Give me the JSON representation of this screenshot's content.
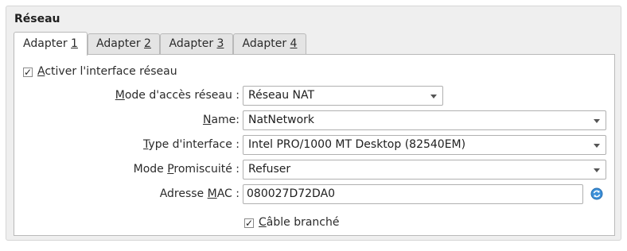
{
  "section": {
    "title": "Réseau"
  },
  "tabs": [
    {
      "label_pre": "Adapter ",
      "label_key": "1"
    },
    {
      "label_pre": "Adapter ",
      "label_key": "2"
    },
    {
      "label_pre": "Adapter ",
      "label_key": "3"
    },
    {
      "label_pre": "Adapter ",
      "label_key": "4"
    }
  ],
  "enable": {
    "label_key": "A",
    "label_rest": "ctiver l'interface réseau",
    "checked_glyph": "✓"
  },
  "attachment": {
    "label_key": "M",
    "label_rest": "ode d'accès réseau :",
    "value": "Réseau NAT"
  },
  "name": {
    "label_key": "N",
    "label_rest": "ame:",
    "value": "NatNetwork"
  },
  "adapter_type": {
    "label_key": "T",
    "label_rest": "ype d'interface :",
    "value": "Intel PRO/1000 MT Desktop (82540EM)"
  },
  "promiscuous": {
    "label_pre": "Mode ",
    "label_key": "P",
    "label_rest": "romiscuité :",
    "value": "Refuser"
  },
  "mac": {
    "label_pre": "Adresse ",
    "label_key": "M",
    "label_rest": "AC :",
    "value": "080027D72DA0"
  },
  "cable": {
    "label_key": "C",
    "label_rest": "âble branché",
    "checked_glyph": "✓"
  },
  "colors": {
    "refresh_icon": "#3b8fd8",
    "panel_border": "#b9b9b9"
  }
}
